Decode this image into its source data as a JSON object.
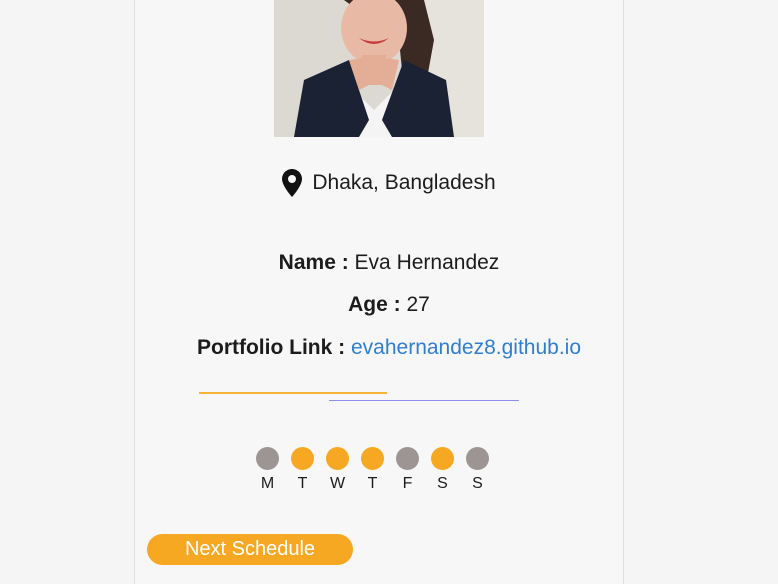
{
  "profile": {
    "location": "Dhaka, Bangladesh",
    "name_label": "Name :",
    "name_value": "Eva Hernandez",
    "age_label": "Age :",
    "age_value": "27",
    "portfolio_label": "Portfolio Link :",
    "portfolio_value": "evahernandez8.github.io"
  },
  "schedule": {
    "days": [
      {
        "letter": "M",
        "active": false
      },
      {
        "letter": "T",
        "active": true
      },
      {
        "letter": "W",
        "active": true
      },
      {
        "letter": "T",
        "active": true
      },
      {
        "letter": "F",
        "active": false
      },
      {
        "letter": "S",
        "active": true
      },
      {
        "letter": "S",
        "active": false
      }
    ],
    "button_label": "Next Schedule"
  },
  "colors": {
    "accent": "#f7a823",
    "inactive_day": "#9d9593",
    "link": "#2f7fd0"
  },
  "icons": {
    "location": "map-pin-icon"
  }
}
